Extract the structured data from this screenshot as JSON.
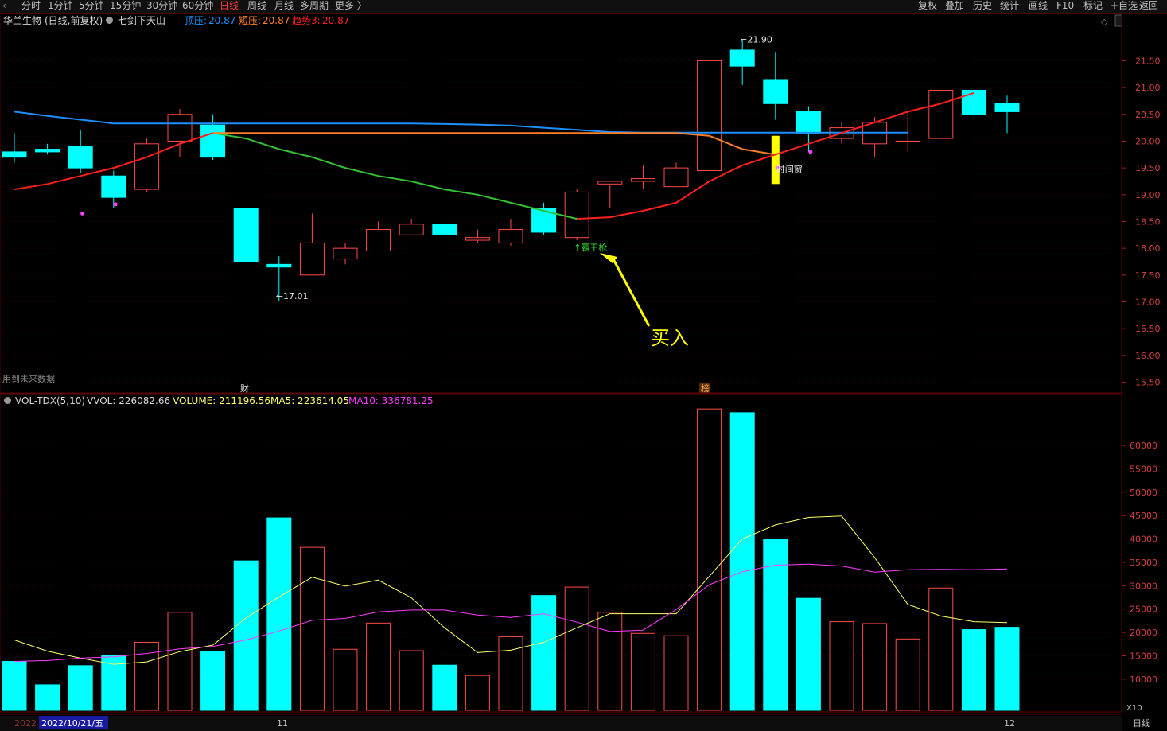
{
  "toolbar": {
    "periods": [
      "分时",
      "1分钟",
      "5分钟",
      "15分钟",
      "30分钟",
      "60分钟",
      "日线",
      "周线",
      "月线",
      "多周期",
      "更多"
    ],
    "active_period": "日线",
    "actions": [
      "复权",
      "叠加",
      "历史",
      "统计",
      "画线",
      "F10",
      "标记",
      "+自选",
      "返回"
    ]
  },
  "info": {
    "stock": "华兰生物",
    "mode": "(日线,前复权)",
    "formula": "七剑下天山",
    "top_label": "顶压:",
    "top_value": "20.87",
    "short_label": "短压:",
    "short_value": "20.87",
    "trend_label": "趋势3:",
    "trend_value": "20.87"
  },
  "annotations": {
    "high": "21.90",
    "low": "17.01",
    "buy_signal": "霸王枪",
    "time_window": "时间窗",
    "buy_text": "买入",
    "future_note": "用到未来数据",
    "marker_cai": "财",
    "marker_bang": "榜"
  },
  "volume_info": {
    "name": "VOL-TDX(5,10)",
    "vvol": "VVOL: 226082.66",
    "volume": "VOLUME: 211196.56",
    "ma5": "MA5: 223614.05",
    "ma10": "MA10: 336781.25",
    "corner": "X10"
  },
  "bottom": {
    "year_partial": "2022",
    "date_cursor": "2022/10/21/五",
    "month_11": "11",
    "month_12": "12",
    "period": "日线"
  },
  "colors": {
    "up": "#ff4a4a",
    "down": "#00ffff",
    "ma_blue": "#1f8fff",
    "ma_orange": "#ff7f27",
    "ma_green": "#35c035",
    "ma_red": "#ff2020",
    "ma5_vol": "#ffff66",
    "ma10_vol": "#ff3cff",
    "arrow": "#ffff00",
    "grid": "#5a0000"
  },
  "chart_data": [
    {
      "type": "candlestick",
      "title": "华兰生物 (日线,前复权)",
      "price_ticks": [
        "21.50",
        "21.00",
        "20.50",
        "20.00",
        "19.50",
        "19.00",
        "18.50",
        "18.00",
        "17.50",
        "17.00",
        "16.50",
        "16.00",
        "15.50"
      ],
      "ylim": [
        15.3,
        22.1
      ],
      "candles": [
        {
          "o": 19.8,
          "h": 20.15,
          "l": 19.6,
          "c": 19.7
        },
        {
          "o": 19.85,
          "h": 19.95,
          "l": 19.75,
          "c": 19.8
        },
        {
          "o": 19.9,
          "h": 20.2,
          "l": 19.4,
          "c": 19.5
        },
        {
          "o": 19.35,
          "h": 19.45,
          "l": 18.75,
          "c": 18.95
        },
        {
          "o": 19.1,
          "h": 20.05,
          "l": 19.05,
          "c": 19.95
        },
        {
          "o": 20.0,
          "h": 20.6,
          "l": 19.7,
          "c": 20.5
        },
        {
          "o": 20.3,
          "h": 20.5,
          "l": 19.65,
          "c": 19.7
        },
        {
          "o": 18.75,
          "h": 18.75,
          "l": 17.75,
          "c": 17.75
        },
        {
          "o": 17.7,
          "h": 17.85,
          "l": 17.01,
          "c": 17.65
        },
        {
          "o": 17.5,
          "h": 18.65,
          "l": 17.5,
          "c": 18.1
        },
        {
          "o": 17.8,
          "h": 18.1,
          "l": 17.7,
          "c": 18.0
        },
        {
          "o": 17.95,
          "h": 18.5,
          "l": 17.95,
          "c": 18.35
        },
        {
          "o": 18.25,
          "h": 18.55,
          "l": 18.25,
          "c": 18.45
        },
        {
          "o": 18.45,
          "h": 18.45,
          "l": 18.25,
          "c": 18.25
        },
        {
          "o": 18.15,
          "h": 18.35,
          "l": 18.1,
          "c": 18.2
        },
        {
          "o": 18.1,
          "h": 18.55,
          "l": 18.05,
          "c": 18.35
        },
        {
          "o": 18.75,
          "h": 18.85,
          "l": 18.25,
          "c": 18.3
        },
        {
          "o": 18.2,
          "h": 19.1,
          "l": 18.15,
          "c": 19.05
        },
        {
          "o": 19.2,
          "h": 19.25,
          "l": 18.75,
          "c": 19.25
        },
        {
          "o": 19.25,
          "h": 19.55,
          "l": 19.1,
          "c": 19.3
        },
        {
          "o": 19.15,
          "h": 19.6,
          "l": 19.15,
          "c": 19.5
        },
        {
          "o": 19.45,
          "h": 21.5,
          "l": 19.45,
          "c": 21.5
        },
        {
          "o": 21.7,
          "h": 21.9,
          "l": 21.05,
          "c": 21.4
        },
        {
          "o": 21.15,
          "h": 21.65,
          "l": 20.4,
          "c": 20.7
        },
        {
          "o": 20.55,
          "h": 20.65,
          "l": 19.8,
          "c": 20.15
        },
        {
          "o": 20.05,
          "h": 20.35,
          "l": 19.95,
          "c": 20.25
        },
        {
          "o": 19.95,
          "h": 20.45,
          "l": 19.7,
          "c": 20.35
        },
        {
          "o": 20.0,
          "h": 20.55,
          "l": 19.8,
          "c": 20.0
        },
        {
          "o": 20.05,
          "h": 20.95,
          "l": 20.05,
          "c": 20.95
        },
        {
          "o": 20.95,
          "h": 20.95,
          "l": 20.4,
          "c": 20.5
        },
        {
          "o": 20.7,
          "h": 20.85,
          "l": 20.15,
          "c": 20.55
        }
      ],
      "lines": {
        "blue": [
          20.55,
          20.47,
          20.4,
          20.33,
          20.33,
          20.33,
          20.33,
          20.33,
          20.33,
          20.33,
          20.33,
          20.33,
          20.33,
          20.32,
          20.31,
          20.29,
          20.25,
          20.21,
          20.17,
          20.16,
          20.16,
          20.16,
          20.16,
          20.16,
          20.16,
          20.16,
          20.16,
          20.16,
          null,
          null,
          null
        ],
        "orange": [
          null,
          null,
          null,
          null,
          null,
          null,
          20.15,
          20.15,
          20.15,
          20.15,
          20.15,
          20.15,
          20.15,
          20.15,
          20.15,
          20.15,
          20.15,
          20.15,
          20.15,
          20.15,
          20.15,
          20.1,
          19.85,
          19.75,
          null,
          null,
          null,
          null,
          null,
          null,
          null
        ],
        "green": [
          null,
          null,
          null,
          null,
          null,
          null,
          20.15,
          20.05,
          19.85,
          19.7,
          19.5,
          19.35,
          19.25,
          19.1,
          19.0,
          18.85,
          18.7,
          18.55,
          null,
          null,
          null,
          null,
          null,
          null,
          null,
          null,
          null,
          null,
          null,
          null,
          null
        ],
        "red": [
          19.1,
          19.2,
          19.35,
          19.5,
          19.7,
          19.95,
          20.15,
          null,
          null,
          null,
          null,
          null,
          null,
          null,
          null,
          null,
          null,
          18.55,
          18.58,
          18.7,
          18.85,
          19.25,
          19.55,
          19.75,
          19.95,
          20.15,
          20.35,
          20.55,
          20.7,
          20.9,
          null
        ]
      },
      "time_window_bar": {
        "index": 23,
        "from": 20.1,
        "to": 19.2
      },
      "pink_dots": [
        {
          "i": 1,
          "v": 18.65
        },
        {
          "i": 2,
          "v": 18.82
        },
        {
          "i": 22,
          "v": 19.5
        },
        {
          "i": 23,
          "v": 19.8
        }
      ]
    },
    {
      "type": "bar",
      "title": "VOL-TDX(5,10)",
      "volume_ticks": [
        "60000",
        "55000",
        "50000",
        "45000",
        "40000",
        "35000",
        "30000",
        "25000",
        "20000",
        "15000",
        "10000"
      ],
      "ylim": [
        3000,
        68000
      ],
      "unit": "X10",
      "volumes": [
        13800,
        8800,
        12900,
        15100,
        17900,
        24300,
        15900,
        35300,
        44500,
        38200,
        16400,
        22000,
        16100,
        13000,
        10800,
        19100,
        27900,
        29700,
        24300,
        19800,
        19300,
        67800,
        67000,
        40000,
        27300,
        22300,
        21900,
        18600,
        29500,
        20600,
        21100
      ],
      "ma5": [
        18400,
        16000,
        14500,
        13200,
        13700,
        15900,
        17300,
        23100,
        27600,
        31800,
        29900,
        31200,
        27400,
        21000,
        15700,
        16200,
        17900,
        21000,
        24000,
        24000,
        24000,
        32000,
        40000,
        43000,
        44600,
        44900,
        36000,
        26000,
        23500,
        22300,
        22100
      ],
      "ma10": [
        13800,
        14000,
        14500,
        14800,
        15500,
        16500,
        17000,
        18400,
        20300,
        22600,
        23000,
        24400,
        24800,
        24800,
        23700,
        23200,
        24000,
        22200,
        20200,
        20500,
        24900,
        30200,
        33000,
        34400,
        34600,
        34200,
        32900,
        33400,
        33500,
        33400,
        33600
      ]
    }
  ]
}
